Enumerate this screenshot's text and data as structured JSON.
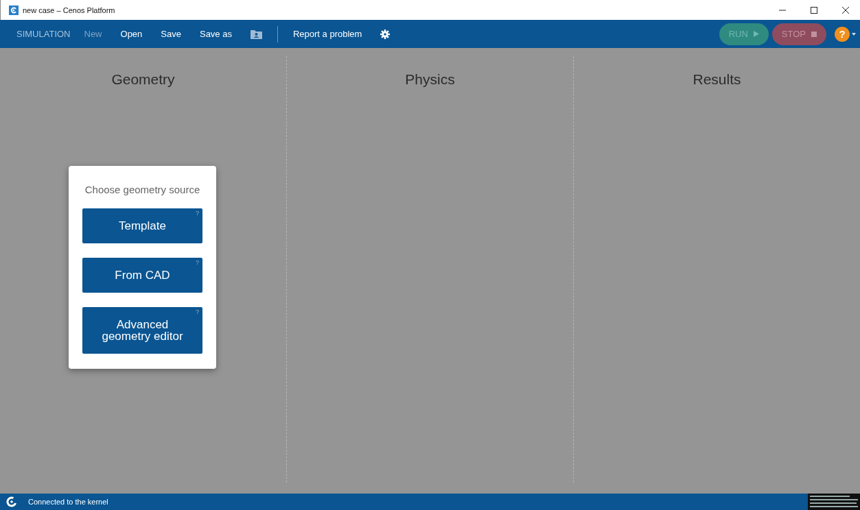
{
  "window": {
    "title": "new case – Cenos Platform"
  },
  "menu": {
    "label": "SIMULATION",
    "items": [
      {
        "kind": "text",
        "label": "New",
        "disabled": true
      },
      {
        "kind": "text",
        "label": "Open",
        "disabled": false
      },
      {
        "kind": "text",
        "label": "Save",
        "disabled": false
      },
      {
        "kind": "text",
        "label": "Save as",
        "disabled": false
      },
      {
        "kind": "folder",
        "disabled": false
      },
      {
        "kind": "separator"
      },
      {
        "kind": "text",
        "label": "Report a problem",
        "disabled": false
      },
      {
        "kind": "gear",
        "disabled": false
      }
    ]
  },
  "actions": [
    {
      "kind": "run",
      "label": "RUN",
      "disabled": true
    },
    {
      "kind": "stop",
      "label": "STOP",
      "disabled": true
    }
  ],
  "help": {
    "label": "?"
  },
  "columns": [
    {
      "title": "Geometry"
    },
    {
      "title": "Physics"
    },
    {
      "title": "Results"
    }
  ],
  "geometry_card": {
    "title": "Choose geometry source",
    "options": [
      {
        "label": "Template",
        "hint": "?"
      },
      {
        "label": "From CAD",
        "hint": "?"
      },
      {
        "label": "Advanced geometry editor",
        "hint": "?"
      }
    ]
  },
  "status_bar": {
    "text": "Connected to the kernel"
  }
}
